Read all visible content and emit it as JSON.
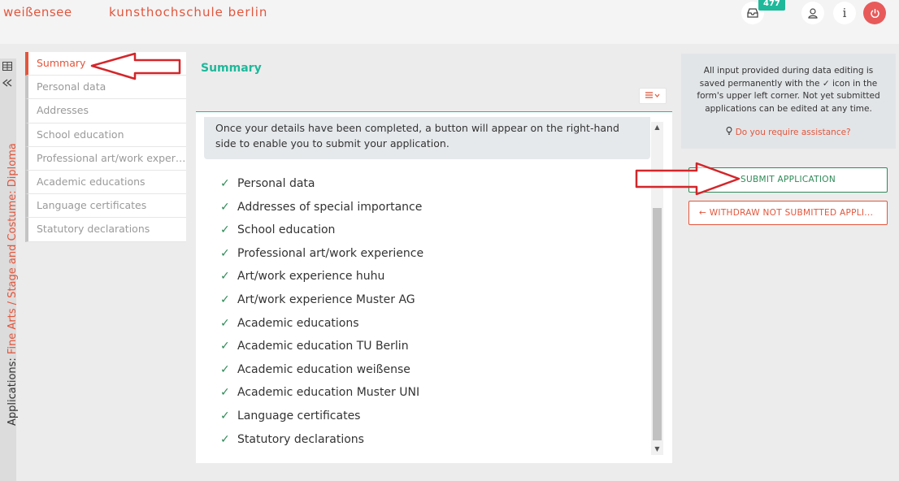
{
  "header": {
    "logo": "weißensee",
    "school": "kunsthochschule berlin",
    "inbox_badge": "477",
    "info_glyph": "i"
  },
  "sidebar_vertical": {
    "prefix": "Applications: ",
    "program": "Fine Arts / Stage and Costume: Diploma"
  },
  "nav": {
    "items": [
      {
        "label": "Summary",
        "active": true
      },
      {
        "label": "Personal data"
      },
      {
        "label": "Addresses"
      },
      {
        "label": "School education"
      },
      {
        "label": "Professional art/work experience"
      },
      {
        "label": "Academic educations"
      },
      {
        "label": "Language certificates"
      },
      {
        "label": "Statutory declarations"
      }
    ]
  },
  "main": {
    "title": "Summary",
    "notice": "Once your details have been completed, a button will appear on the right-hand side to enable you to submit your application.",
    "checklist": [
      "Personal data",
      "Addresses of special importance",
      "School education",
      "Professional art/work experience",
      "Art/work experience huhu",
      "Art/work experience Muster AG",
      "Academic educations",
      "Academic education TU Berlin",
      "Academic education weißense",
      "Academic education Muster UNI",
      "Language certificates",
      "Statutory declarations"
    ]
  },
  "right": {
    "info_text_1": "All input provided during data editing is saved permanently with the",
    "info_text_2": "icon in the form's upper left corner. Not yet submitted applications can be edited at any time.",
    "help": "Do you require assistance?",
    "submit": "SUBMIT APPLICATION",
    "withdraw": "WITHDRAW NOT SUBMITTED APPLI..."
  },
  "colors": {
    "accent": "#e2563c",
    "teal": "#1fb89a",
    "green": "#2e8b57"
  }
}
